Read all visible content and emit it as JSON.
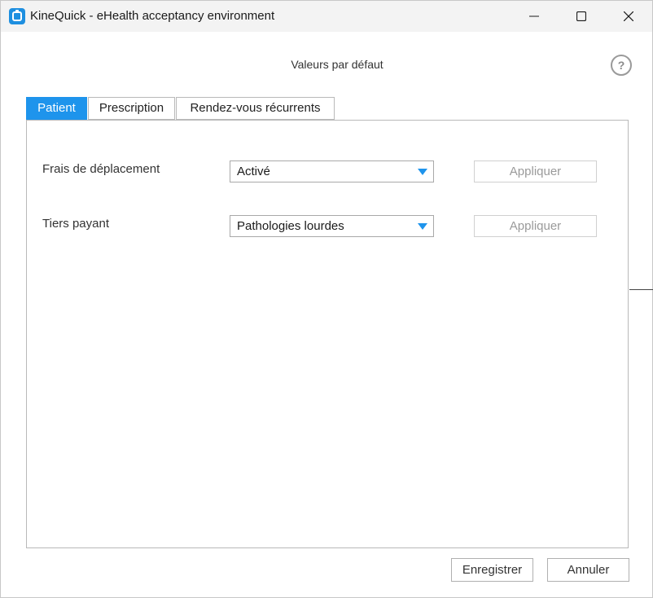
{
  "window": {
    "title": "KineQuick - eHealth acceptancy environment",
    "app_icon": "kinequick-logo-icon",
    "controls": [
      "minimize-icon",
      "maximize-icon",
      "close-icon"
    ]
  },
  "header": {
    "title": "Valeurs par défaut",
    "help_label": "?"
  },
  "tabs": [
    {
      "label": "Patient",
      "active": true
    },
    {
      "label": "Prescription",
      "active": false
    },
    {
      "label": "Rendez-vous récurrents",
      "active": false
    }
  ],
  "fields": [
    {
      "label": "Frais de déplacement",
      "value": "Activé",
      "apply_label": "Appliquer"
    },
    {
      "label": "Tiers payant",
      "value": "Pathologies lourdes",
      "apply_label": "Appliquer"
    }
  ],
  "footer": {
    "save_label": "Enregistrer",
    "cancel_label": "Annuler"
  },
  "colors": {
    "accent": "#1e94ec",
    "titlebar": "#f3f3f3",
    "disabled_text": "#9a9a9a"
  }
}
